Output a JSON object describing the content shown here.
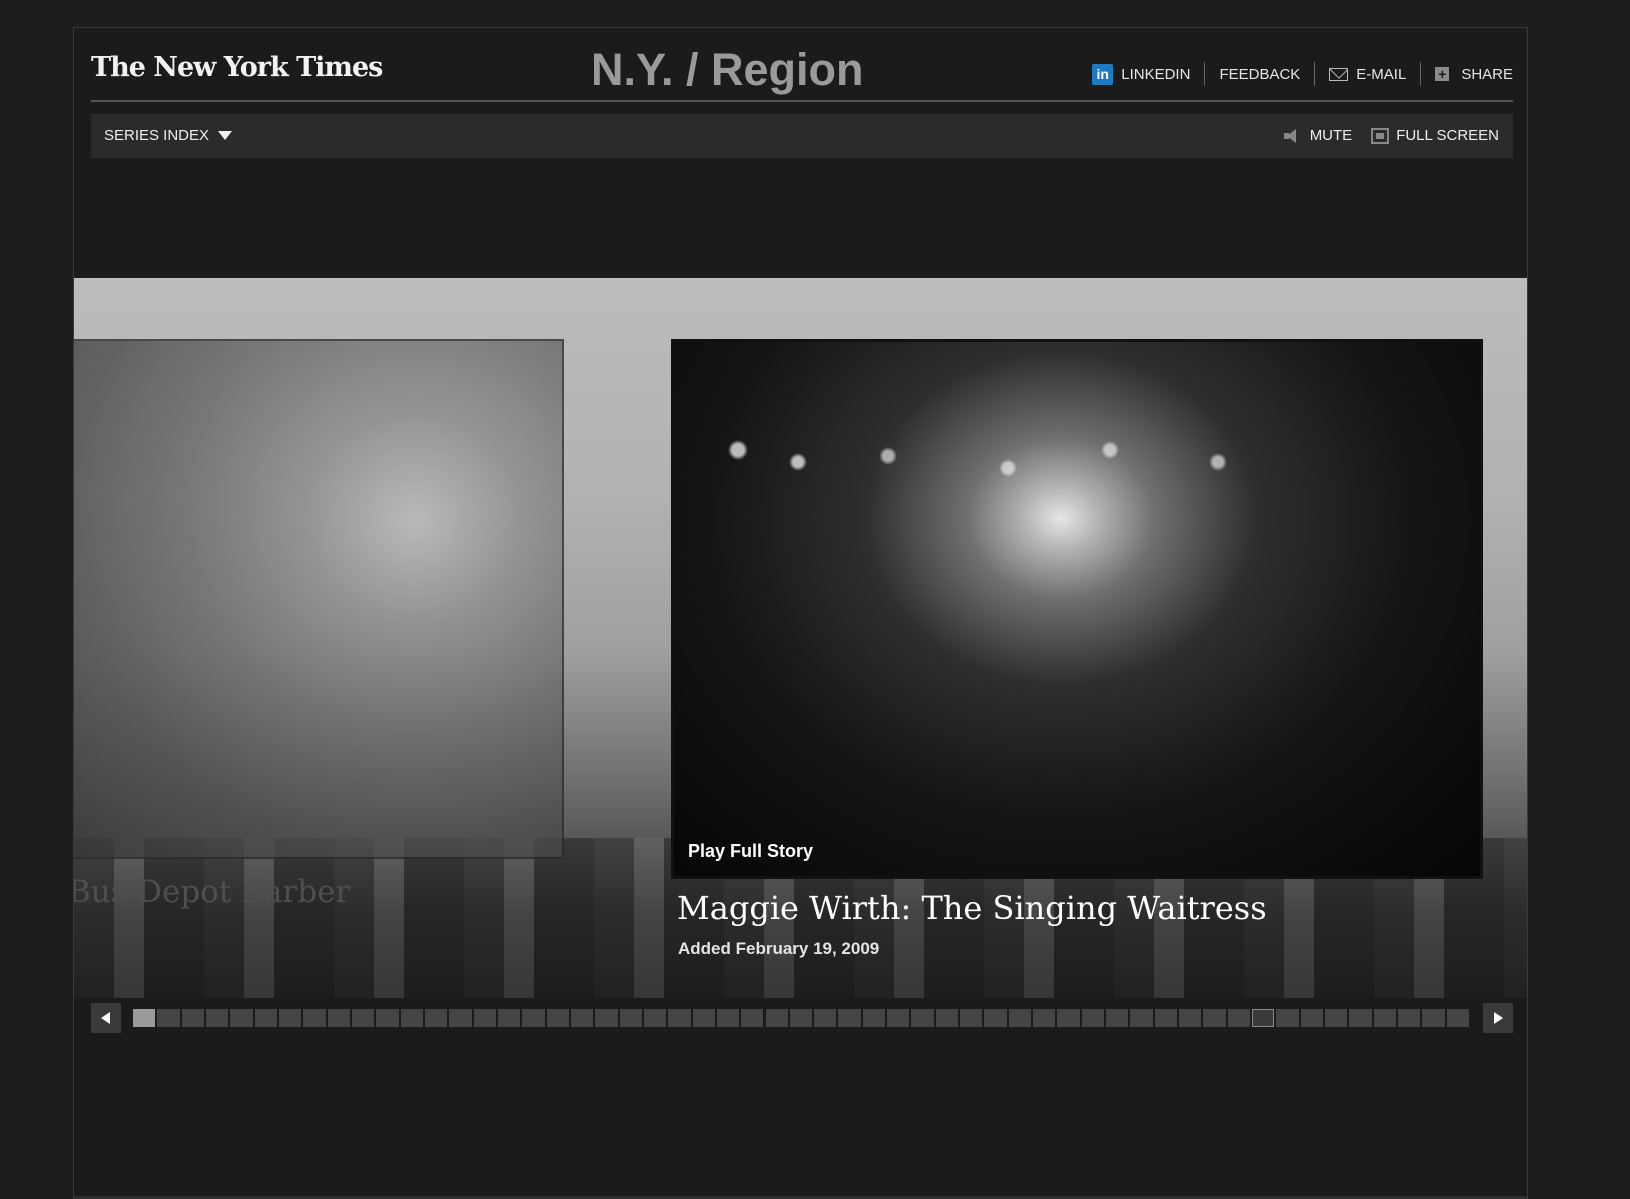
{
  "header": {
    "logo": "The New York Times",
    "section_title": "N.Y. / Region",
    "links": {
      "linkedin": "LINKEDIN",
      "linkedin_icon": "in",
      "feedback": "FEEDBACK",
      "email": "E-MAIL",
      "share": "SHARE",
      "share_icon": "+"
    }
  },
  "navbar": {
    "series_index": "SERIES INDEX",
    "mute": "MUTE",
    "full_screen": "FULL SCREEN"
  },
  "carousel": {
    "previous_story": {
      "title": "Bus-Depot Barber"
    },
    "current_story": {
      "title": "Maggie Wirth: The Singing Waitress",
      "date": "Added February 19, 2009",
      "play_label": "Play Full Story"
    }
  },
  "scrubber": {
    "total_items": 55,
    "active_index": 0,
    "current_index": 46
  },
  "colors": {
    "background": "#1d1d1d",
    "linkedin_blue": "#1f7bc1"
  }
}
